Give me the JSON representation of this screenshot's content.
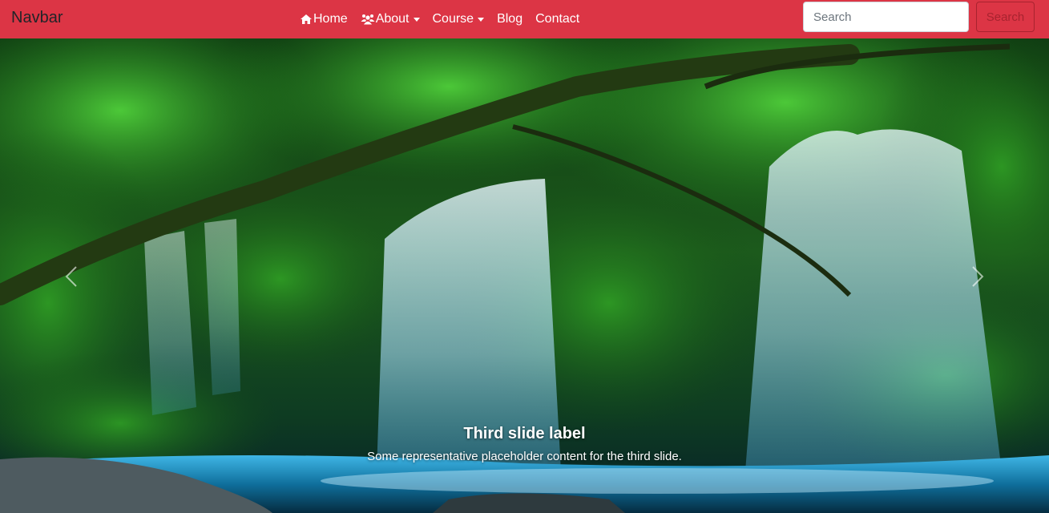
{
  "navbar": {
    "brand": "Navbar",
    "items": [
      {
        "label": "Home",
        "icon": "home-icon",
        "dropdown": false
      },
      {
        "label": "About",
        "icon": "users-icon",
        "dropdown": true
      },
      {
        "label": "Course",
        "icon": "",
        "dropdown": true
      },
      {
        "label": "Blog",
        "icon": "",
        "dropdown": false
      },
      {
        "label": "Contact",
        "icon": "",
        "dropdown": false
      }
    ],
    "search": {
      "placeholder": "Search",
      "value": "",
      "button_label": "Search"
    },
    "colors": {
      "background": "#dc3545",
      "brand_text": "#212529",
      "link_text": "#ffffff",
      "search_button": "#a8232f"
    }
  },
  "carousel": {
    "caption": {
      "title": "Third slide label",
      "text": "Some representative placeholder content for the third slide."
    },
    "controls": {
      "prev_icon": "chevron-left-icon",
      "next_icon": "chevron-right-icon"
    },
    "image_subject": "waterfall-forest-scene"
  }
}
